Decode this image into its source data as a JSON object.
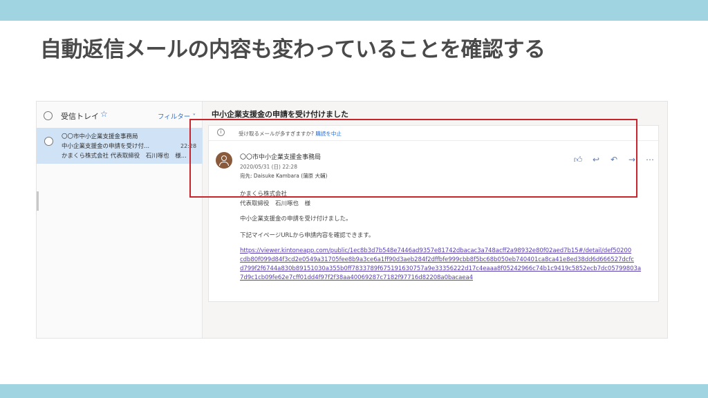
{
  "slide": {
    "title": "自動返信メールの内容も変わっていることを確認する",
    "bar_color": "#9fd4e0",
    "highlight_color": "#c8222a"
  },
  "sidebar": {
    "folder_name": "受信トレイ",
    "favorite_icon": "star-icon",
    "filter_label": "フィルター ˅",
    "mail_item": {
      "sender": "〇〇市中小企業支援金事務局",
      "subject": "中小企業支援金の申請を受け付...",
      "time": "22:28",
      "preview": "かまくら株式会社 代表取締役　石川啄也　様..."
    }
  },
  "reading_pane": {
    "subject": "中小企業支援金の申請を受け付けました",
    "info_text": "受け取るメールが多すぎますか?",
    "info_link": "購読を中止",
    "sender": "〇〇市中小企業支援金事務局",
    "date": "2020/05/31 (日) 22:28",
    "to": "宛先: Daisuke Kambara (蒲原 大輔)",
    "actions": [
      "like-icon",
      "reply-icon",
      "reply-all-icon",
      "forward-icon",
      "more-icon"
    ],
    "body": {
      "company": "かまくら株式会社",
      "recipient": "代表取締役　石川啄也　様",
      "line1": "中小企業支援金の申請を受け付けました。",
      "line2": "下記マイページURLから申請内容を確認できます。",
      "url_lines": [
        "https://viewer.kintoneapp.com/public/1ec8b3d7b548e7446ad9357e81742dbacac3a748acff2a98932e80f02aed7b15#/detail/def50200",
        "cdb80f099d84f3cd2e0549a31705fee8b9a3ce6a1ff90d3aeb284f2dffbfe999cbb8f5bc68b050eb740401ca8ca41e8ed38dd6d666527dcfc",
        "d799f2f6744a830b89151030a355b0ff7833789f675191630757a9e33356222d17c4eaaa8f05242966c74b1c9419c5852ecb7dc05799803a",
        "7d9c1cb09fe62e7cff01dd4f97f2f38aa40069287c7182f97716d82208a0bacaea4"
      ]
    }
  }
}
